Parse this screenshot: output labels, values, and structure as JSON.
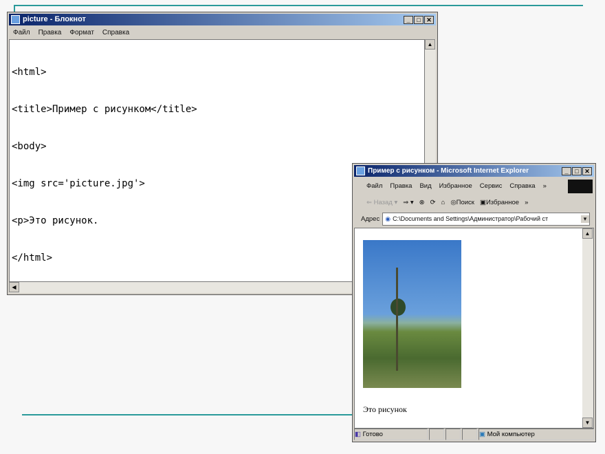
{
  "notepad": {
    "title": "picture - Блокнот",
    "menu": [
      "Файл",
      "Правка",
      "Формат",
      "Справка"
    ],
    "lines": [
      "<html>",
      "<title>Пример с рисунком</title>",
      "<body>",
      "<img src='picture.jpg'>",
      "<p>Это рисунок.",
      "</html>"
    ]
  },
  "ie": {
    "title": "Пример с рисунком - Microsoft Internet Explorer",
    "menu": [
      "Файл",
      "Правка",
      "Вид",
      "Избранное",
      "Сервис",
      "Справка"
    ],
    "toolbar": {
      "back": "Назад",
      "search": "Поиск",
      "favorites": "Избранное"
    },
    "address_label": "Адрес",
    "address": "C:\\Documents and Settings\\Администратор\\Рабочий ст",
    "content_text": "Это рисунок",
    "status": "Готово",
    "zone": "Мой компьютер"
  },
  "colors": {
    "accent_line": "#2a9a9a",
    "titlebar": "#0a246a"
  }
}
